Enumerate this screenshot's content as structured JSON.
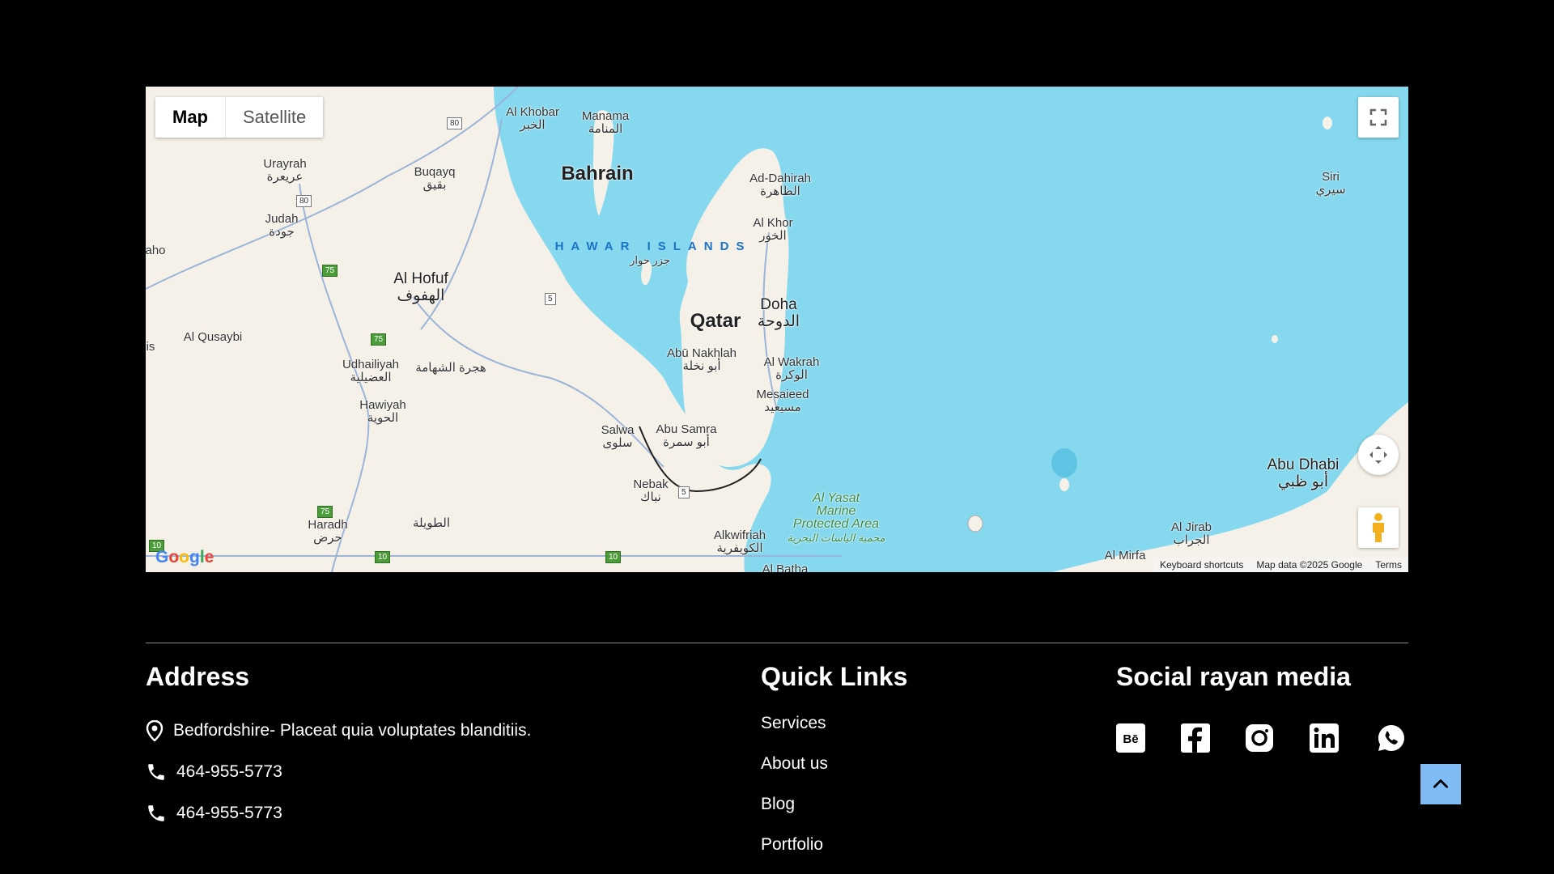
{
  "map": {
    "type_buttons": [
      "Map",
      "Satellite"
    ],
    "labels": {
      "bahrain": "Bahrain",
      "qatar": "Qatar",
      "doha_en": "Doha",
      "doha_ar": "الدوحة",
      "manama_en": "Manama",
      "manama_ar": "المنامة",
      "alkhobar_en": "Al Khobar",
      "alkhobar_ar": "الخبر",
      "hawar": "HAWAR ISLANDS",
      "alhofuf_en": "Al Hofuf",
      "alhofuf_ar": "الهفوف",
      "urayrah_en": "Urayrah",
      "urayrah_ar": "عريعرة",
      "buqayq_en": "Buqayq",
      "buqayq_ar": "بقيق",
      "judah_en": "Judah",
      "judah_ar": "جودة",
      "alqusaybi": "Al Qusaybi",
      "udhailiyah_en": "Udhailiyah",
      "udhailiyah_ar": "العضيلية",
      "hijratshahama": "هجرة الشهامة",
      "hawiyah_en": "Hawiyah",
      "hawiyah_ar": "الحوية",
      "haradh_en": "Haradh",
      "haradh_ar": "حرض",
      "tawilah": "الطويلة",
      "salwa_en": "Salwa",
      "salwa_ar": "سلوى",
      "abusamra_en": "Abu Samra",
      "abusamra_ar": "أبو سمرة",
      "nebak_en": "Nebak",
      "nebak_ar": "نباك",
      "alkwifriah_en": "Alkwifriah",
      "alkwifriah_ar": "الكويفرية",
      "albatha": "Al Batha",
      "abunakhlah_en": "Abū Nakhlah",
      "abunakhlah_ar": "أبو نخلة",
      "alwakrah_en": "Al Wakrah",
      "alwakrah_ar": "الوكرة",
      "mesaieed_en": "Mesaieed",
      "mesaieed_ar": "مسيعيد",
      "addahirah_en": "Ad-Dahirah",
      "addahirah_ar": "الظاهرة",
      "alkhor_en": "Al Khor",
      "alkhor_ar": "الخور",
      "siri_en": "Siri",
      "siri_ar": "سيري",
      "abudhabi_en": "Abu Dhabi",
      "abudhabi_ar": "أبو ظبي",
      "aljirab_en": "Al Jirab",
      "aljirab_ar": "الجراب",
      "almirfa": "Al Mirfa",
      "alyasat": "Al Yasat Marine Protected Area",
      "alyasat_ar": "محمية الياسات البحرية",
      "aho": "aho",
      "is": "is",
      "hawar_ar": "جزر حوار"
    },
    "road_shields": [
      "80",
      "80",
      "75",
      "75",
      "5",
      "5",
      "75",
      "10",
      "10",
      "10"
    ],
    "attribution": {
      "keyboard": "Keyboard shortcuts",
      "data": "Map data ©2025 Google",
      "terms": "Terms"
    },
    "logo": "Google"
  },
  "footer": {
    "address": {
      "title": "Address",
      "location": "Bedfordshire- Placeat quia voluptates blanditiis.",
      "phone1": "464-955-5773",
      "phone2": "464-955-5773"
    },
    "quick_links": {
      "title": "Quick Links",
      "items": [
        "Services",
        "About us",
        "Blog",
        "Portfolio"
      ]
    },
    "social": {
      "title": "Social rayan media",
      "icons": [
        "behance-icon",
        "facebook-icon",
        "instagram-icon",
        "linkedin-icon",
        "whatsapp-icon"
      ]
    }
  },
  "colors": {
    "background": "#000000",
    "water": "#86d8ee",
    "land": "#f5f1e8",
    "scroll_top": "#7fbcf5"
  }
}
